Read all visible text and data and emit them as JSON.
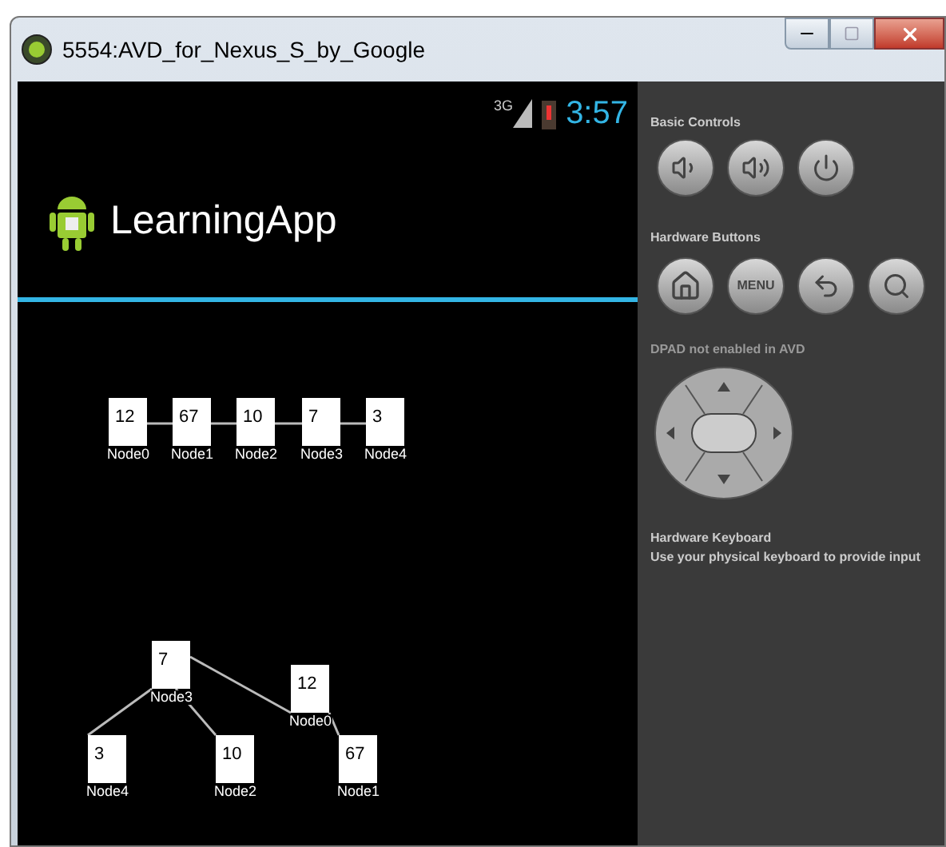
{
  "window": {
    "title": "5554:AVD_for_Nexus_S_by_Google"
  },
  "status_bar": {
    "network": "3G",
    "time": "3:57"
  },
  "action_bar": {
    "title": "LearningApp"
  },
  "list_diagram": {
    "nodes": [
      {
        "value": "12",
        "label": "Node0"
      },
      {
        "value": "67",
        "label": "Node1"
      },
      {
        "value": "10",
        "label": "Node2"
      },
      {
        "value": "7",
        "label": "Node3"
      },
      {
        "value": "3",
        "label": "Node4"
      }
    ]
  },
  "tree_diagram": {
    "nodes": [
      {
        "value": "7",
        "label": "Node3"
      },
      {
        "value": "12",
        "label": "Node0"
      },
      {
        "value": "3",
        "label": "Node4"
      },
      {
        "value": "10",
        "label": "Node2"
      },
      {
        "value": "67",
        "label": "Node1"
      }
    ]
  },
  "controls": {
    "basic_title": "Basic Controls",
    "basic_buttons": [
      {
        "kind": "volume_down"
      },
      {
        "kind": "volume_up"
      },
      {
        "kind": "power"
      }
    ],
    "hardware_title": "Hardware Buttons",
    "hardware_buttons": [
      {
        "kind": "home"
      },
      {
        "kind": "menu",
        "label": "MENU"
      },
      {
        "kind": "back"
      },
      {
        "kind": "search"
      }
    ],
    "dpad_note": "DPAD not enabled in AVD",
    "keyboard_title": "Hardware Keyboard",
    "keyboard_note": "Use your physical keyboard to provide input"
  }
}
